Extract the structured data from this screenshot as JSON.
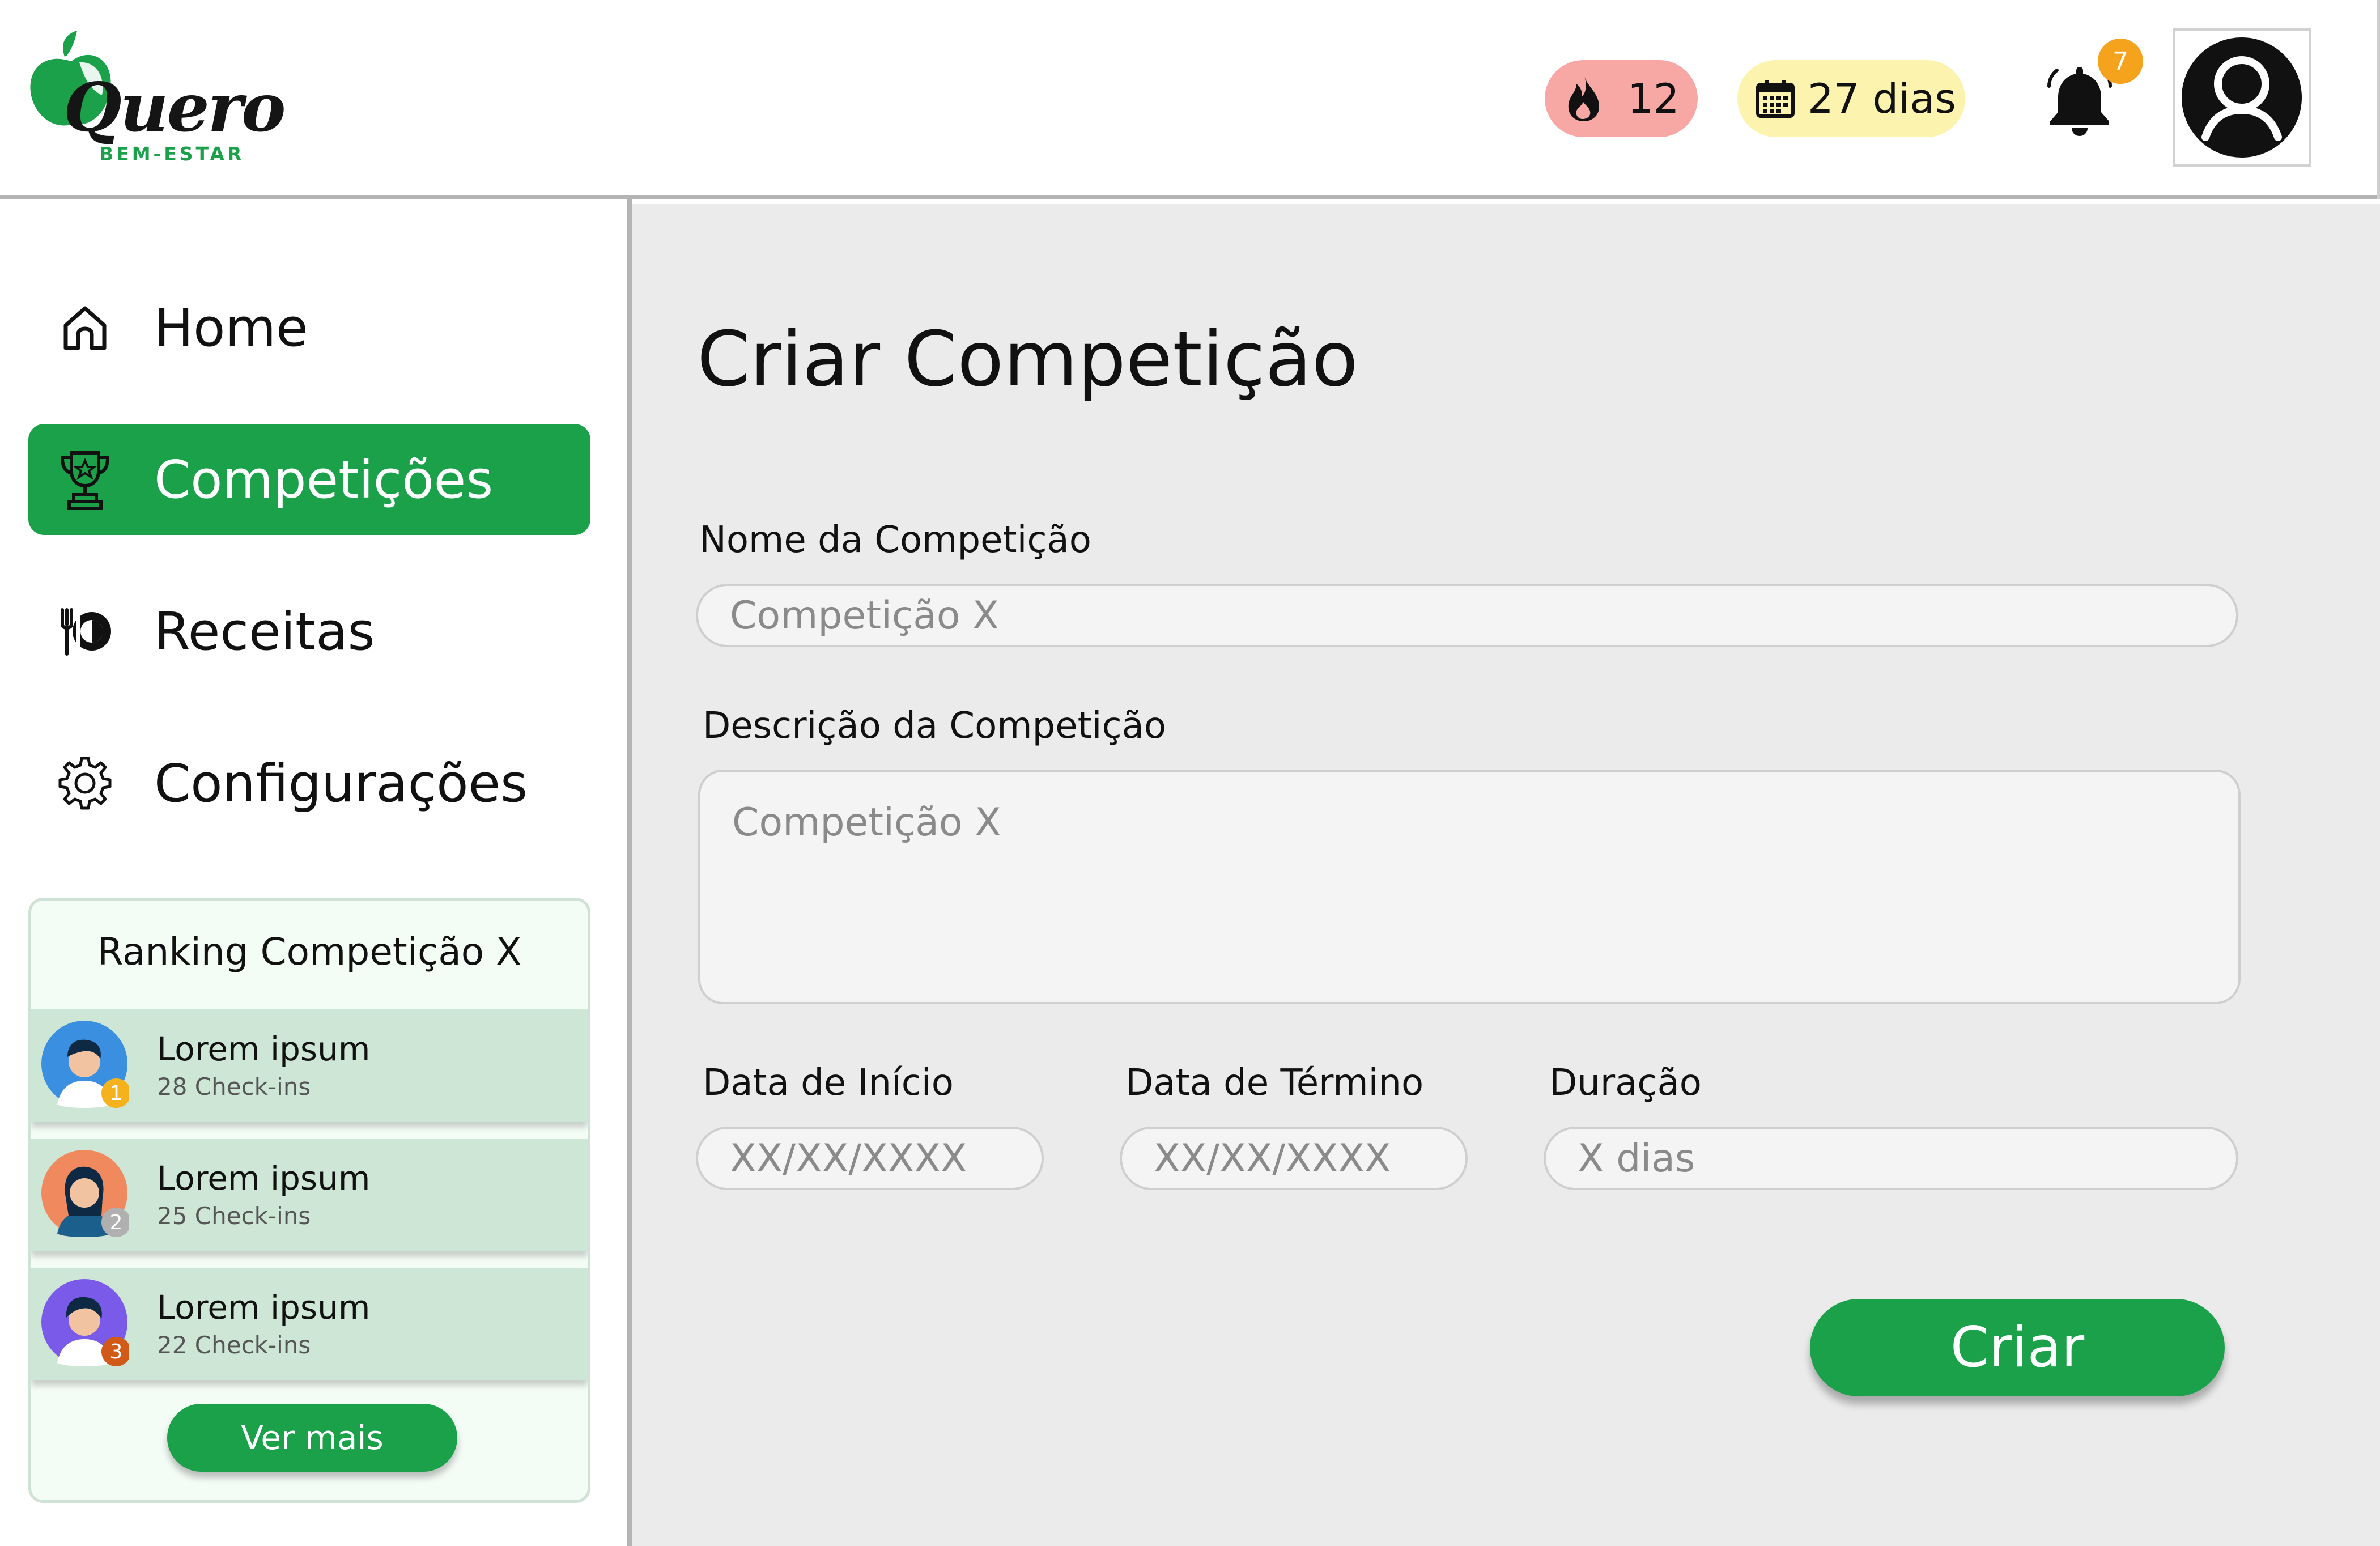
{
  "brand": {
    "name": "Quero",
    "tagline": "BEM-ESTAR",
    "green": "#1aa14a"
  },
  "header": {
    "streak": {
      "icon": "flame-icon",
      "value": "12"
    },
    "days": {
      "icon": "calendar-icon",
      "value": "27 dias"
    },
    "notifications": {
      "icon": "bell-icon",
      "count": "7"
    },
    "profile": {
      "icon": "user-avatar-icon"
    }
  },
  "sidebar": {
    "items": [
      {
        "label": "Home",
        "icon": "home-icon",
        "active": false
      },
      {
        "label": "Competições",
        "icon": "trophy-icon",
        "active": true
      },
      {
        "label": "Receitas",
        "icon": "plate-cutlery-icon",
        "active": false
      },
      {
        "label": "Configurações",
        "icon": "gear-icon",
        "active": false
      }
    ],
    "ranking": {
      "title": "Ranking Competição X",
      "entries": [
        {
          "name": "Lorem ipsum",
          "checkins": "28 Check-ins",
          "position": "1",
          "badge_color": "#f5b21c"
        },
        {
          "name": "Lorem ipsum",
          "checkins": "25 Check-ins",
          "position": "2",
          "badge_color": "#b0b0b0"
        },
        {
          "name": "Lorem ipsum",
          "checkins": "22 Check-ins",
          "position": "3",
          "badge_color": "#d25a18"
        }
      ],
      "more_label": "Ver mais"
    }
  },
  "main": {
    "title": "Criar Competição",
    "name_label": "Nome da Competição",
    "name_placeholder": "Competição X",
    "description_label": "Descrição da Competição",
    "description_placeholder": "Competição X",
    "start_label": "Data de Início",
    "start_placeholder": "XX/XX/XXXX",
    "end_label": "Data de Término",
    "end_placeholder": "XX/XX/XXXX",
    "duration_label": "Duração",
    "duration_placeholder": "X dias",
    "submit_label": "Criar"
  }
}
